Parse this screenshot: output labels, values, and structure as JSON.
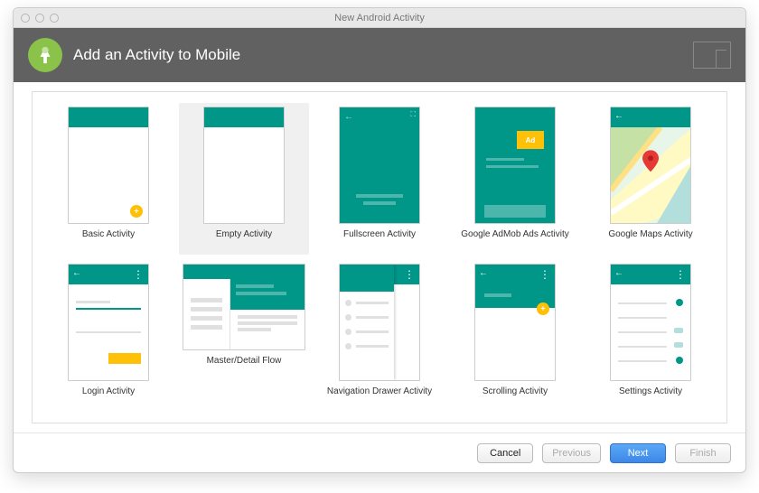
{
  "window": {
    "title": "New Android Activity"
  },
  "header": {
    "title": "Add an Activity to Mobile"
  },
  "selected_index": 1,
  "activities": [
    {
      "label": "Basic Activity"
    },
    {
      "label": "Empty Activity"
    },
    {
      "label": "Fullscreen Activity"
    },
    {
      "label": "Google AdMob Ads Activity"
    },
    {
      "label": "Google Maps Activity"
    },
    {
      "label": "Login Activity"
    },
    {
      "label": "Master/Detail Flow"
    },
    {
      "label": "Navigation Drawer Activity"
    },
    {
      "label": "Scrolling Activity"
    },
    {
      "label": "Settings Activity"
    }
  ],
  "footer": {
    "cancel": "Cancel",
    "previous": "Previous",
    "next": "Next",
    "finish": "Finish"
  }
}
